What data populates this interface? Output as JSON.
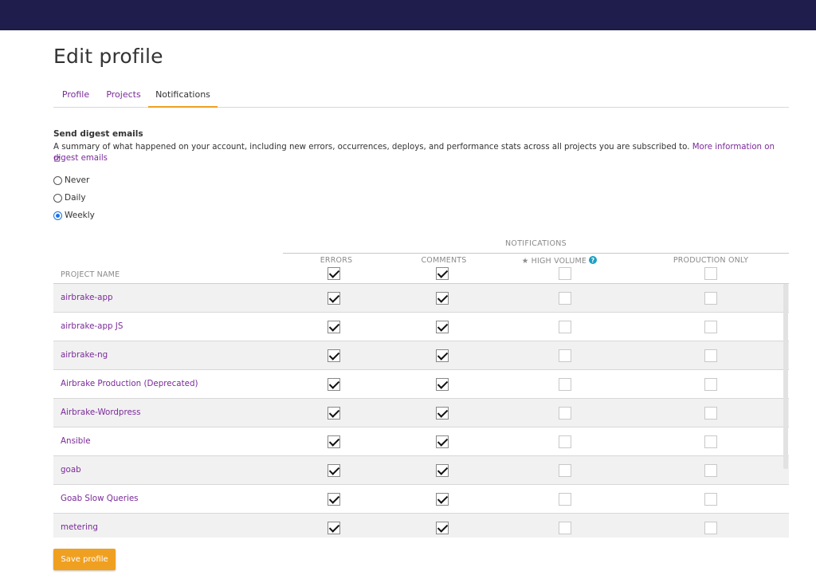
{
  "page_title": "Edit profile",
  "tabs": [
    {
      "label": "Profile",
      "active": false
    },
    {
      "label": "Projects",
      "active": false
    },
    {
      "label": "Notifications",
      "active": true
    }
  ],
  "digest": {
    "title": "Send digest emails",
    "description": "A summary of what happened on your account, including new errors, occurrences, deploys, and performance stats across all projects you are subscribed to.",
    "link_text": "More information on digest emails",
    "options": [
      {
        "label": "Never",
        "checked": false
      },
      {
        "label": "Daily",
        "checked": false
      },
      {
        "label": "Weekly",
        "checked": true
      }
    ]
  },
  "table": {
    "group_header": "NOTIFICATIONS",
    "project_name_header": "PROJECT NAME",
    "columns": [
      {
        "label": "ERRORS",
        "all_checked": true
      },
      {
        "label": "COMMENTS",
        "all_checked": true
      },
      {
        "label": "★ HIGH VOLUME",
        "all_checked": false
      },
      {
        "label": "PRODUCTION ONLY",
        "all_checked": false
      }
    ],
    "rows": [
      {
        "name": "airbrake-app",
        "errors": true,
        "comments": true,
        "high_volume": false,
        "production_only": false
      },
      {
        "name": "airbrake-app JS",
        "errors": true,
        "comments": true,
        "high_volume": false,
        "production_only": false
      },
      {
        "name": "airbrake-ng",
        "errors": true,
        "comments": true,
        "high_volume": false,
        "production_only": false
      },
      {
        "name": "Airbrake Production (Deprecated)",
        "errors": true,
        "comments": true,
        "high_volume": false,
        "production_only": false
      },
      {
        "name": "Airbrake-Wordpress",
        "errors": true,
        "comments": true,
        "high_volume": false,
        "production_only": false
      },
      {
        "name": "Ansible",
        "errors": true,
        "comments": true,
        "high_volume": false,
        "production_only": false
      },
      {
        "name": "goab",
        "errors": true,
        "comments": true,
        "high_volume": false,
        "production_only": false
      },
      {
        "name": "Goab Slow Queries",
        "errors": true,
        "comments": true,
        "high_volume": false,
        "production_only": false
      },
      {
        "name": "metering",
        "errors": true,
        "comments": true,
        "high_volume": false,
        "production_only": false
      }
    ]
  },
  "save_label": "Save profile",
  "colors": {
    "topbar": "#1e1d4c",
    "link": "#7a2a99",
    "accent": "#f0a020",
    "help_icon": "#1aa1c4",
    "radio_checked": "#1a73e8"
  },
  "icons": {
    "external_link": "external-link-icon",
    "help": "question-circle-icon",
    "checkmark": "check-icon"
  }
}
